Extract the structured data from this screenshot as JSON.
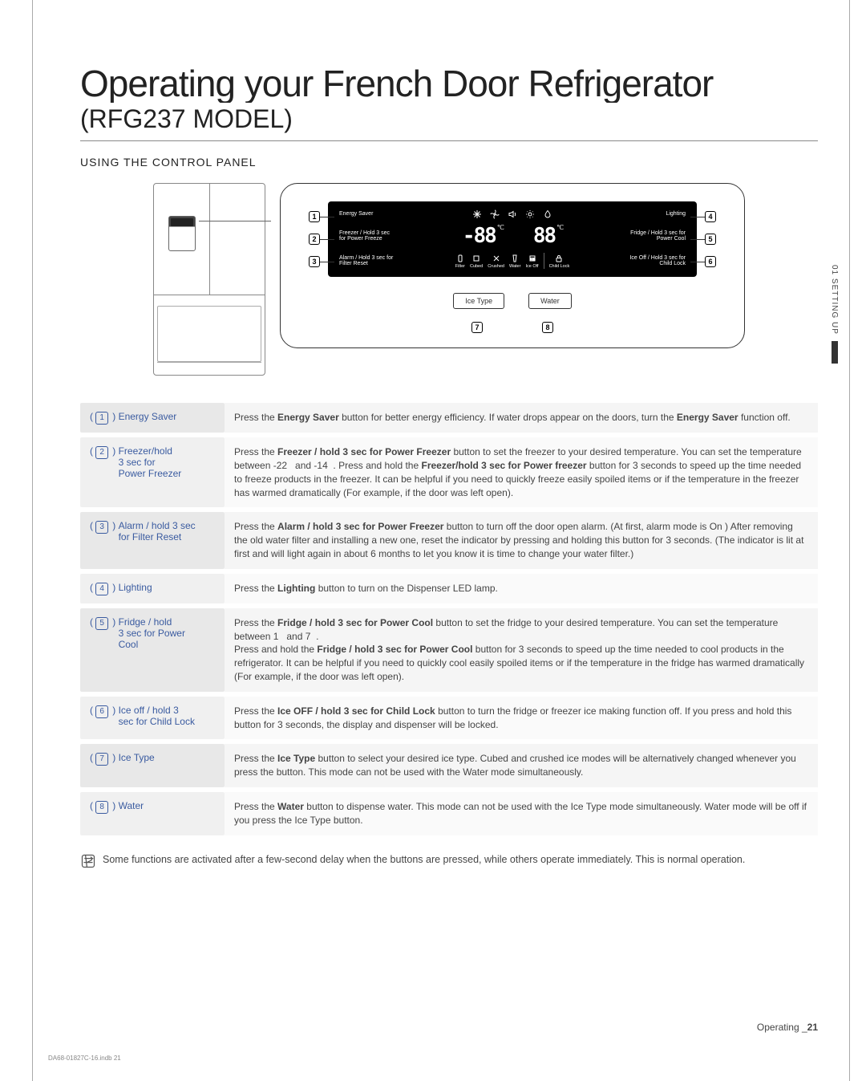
{
  "side_tab": "01 SETTING UP",
  "title_main": "Operating your French Door Refrigerator",
  "title_sub": "(RFG237 MODEL)",
  "section_heading": "USING THE CONTROL PANEL",
  "panel": {
    "row1": {
      "left": "Energy\nSaver",
      "right": "Lighting",
      "icons": [
        "snowflake-icon",
        "fan-icon",
        "sound-icon",
        "brightness-icon",
        "drop-icon"
      ]
    },
    "row2": {
      "left": "Freezer\n/ Hold 3 sec\nfor Power Freeze",
      "right": "Fridge\n/ Hold 3 sec\nfor Power Cool",
      "temp_left": "-88",
      "temp_right": "88",
      "deg": "℃"
    },
    "row3": {
      "left": "Alarm\n/ Hold 3 sec\nfor Filter Reset",
      "right": "Ice Off\n/ Hold 3 sec\nfor Child Lock",
      "sublabels": [
        "Filter",
        "Cubed",
        "Crushed",
        "Water",
        "Ice Off",
        "Child Lock"
      ]
    },
    "markers_left": [
      "1",
      "2",
      "3"
    ],
    "markers_right": [
      "4",
      "5",
      "6"
    ],
    "sub_buttons": [
      "Ice Type",
      "Water"
    ],
    "sub_markers": [
      "7",
      "8"
    ]
  },
  "rows": [
    {
      "num": "1",
      "label": "Energy Saver",
      "desc": "Press the <b>Energy Saver</b> button for better energy efficiency. If water drops appear on the doors, turn the <b>Energy Saver</b> function off."
    },
    {
      "num": "2",
      "label": "Freezer/hold<br>3 sec for<br>Power Freezer",
      "desc": "Press the <b>Freezer / hold 3 sec for Power Freezer</b> button to set the freezer to your desired temperature. You can set the temperature between -22&nbsp;&nbsp; and -14&nbsp;&nbsp;. Press and hold the <b>Freezer/hold 3 sec for Power freezer</b> button for 3 seconds to speed up the time needed to freeze products in the freezer. It can be helpful if you need to quickly freeze easily spoiled items or if the temperature in the freezer has warmed dramatically (For example, if the door was left open)."
    },
    {
      "num": "3",
      "label": "Alarm / hold 3 sec<br>for Filter Reset",
      "desc": "Press the <b>Alarm / hold 3 sec for Power Freezer</b> button to turn off the door open alarm. (At first, alarm mode is On ) After removing the old water filter and installing a new one, reset the indicator by pressing and holding this button for 3 seconds. (The indicator is lit at first and will light again in about 6 months to let you know it is time to change your water filter.)"
    },
    {
      "num": "4",
      "label": "Lighting",
      "desc": "Press the <b>Lighting</b> button to turn on the Dispenser LED lamp."
    },
    {
      "num": "5",
      "label": "Fridge / hold<br>3 sec for Power<br>Cool",
      "desc": "Press the <b>Fridge / hold 3 sec for Power Cool</b> button to set the fridge to your desired temperature. You can set the temperature between 1&nbsp;&nbsp; and 7&nbsp;&nbsp;.<br>Press and hold the <b>Fridge / hold 3 sec for Power Cool</b> button for 3 seconds to speed up the time needed to cool products in the refrigerator. It can be helpful if you need to quickly cool easily spoiled items or if the temperature in the fridge has warmed dramatically (For example, if the door was left open)."
    },
    {
      "num": "6",
      "label": "Ice off / hold  3<br>sec for Child Lock",
      "desc": "Press the <b>Ice OFF / hold 3 sec for Child Lock</b> button to turn the fridge or freezer ice making function off. If you press and hold this button for 3 seconds, the display and dispenser will be locked."
    },
    {
      "num": "7",
      "label": "Ice Type",
      "desc": "Press the <b>Ice Type</b> button to select your desired ice type. Cubed and crushed ice modes will be alternatively changed whenever you press the button. This mode can not be used with the Water mode simultaneously."
    },
    {
      "num": "8",
      "label": "Water",
      "desc": "Press the <b>Water</b> button to dispense water. This mode can not be used with the Ice Type mode simultaneously. Water mode will be off if you press the Ice Type button."
    }
  ],
  "note": "Some functions are activated after a few-second delay when the buttons are pressed, while others operate immediately. This is normal operation.",
  "footer_right_label": "Operating _",
  "footer_right_page": "21",
  "footer_left": "DA68-01827C-16.indb   21"
}
